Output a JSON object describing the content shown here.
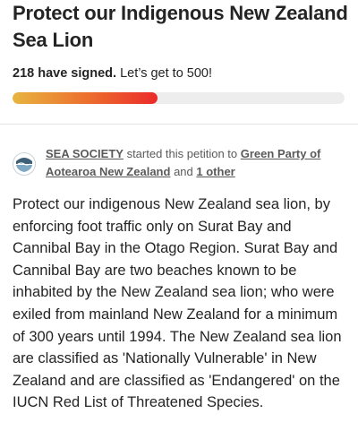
{
  "petition": {
    "title": "Protect our Indigenous New Zealand Sea Lion"
  },
  "signatures": {
    "count_text": "218 have signed.",
    "goal_text": "Let’s get to 500!",
    "progress_fraction": 0.436,
    "progress_colors": [
      "#e8b43f",
      "#ec6a2d",
      "#eb2a2a"
    ]
  },
  "starter": {
    "avatar_icon": "sea-society-logo-icon",
    "organization": "SEA SOCIETY",
    "started_text": "started this petition to",
    "recipient": "Green Party of Aotearoa New Zealand",
    "and_text": "and",
    "others": "1 other"
  },
  "description": {
    "text": "Protect our indigenous New Zealand sea lion, by enforcing foot traffic only on Surat Bay and Cannibal Bay in the Otago Region. Surat Bay and Cannibal Bay are two beaches known to be inhabited by the New Zealand sea lion; who were exiled from mainland New Zealand for a minimum of 300 years until 1994. The New Zealand sea lion are classified as 'Nationally Vulnerable' in New Zealand and are classified as 'Endangered' on the IUCN Red List of Threatened Species."
  }
}
